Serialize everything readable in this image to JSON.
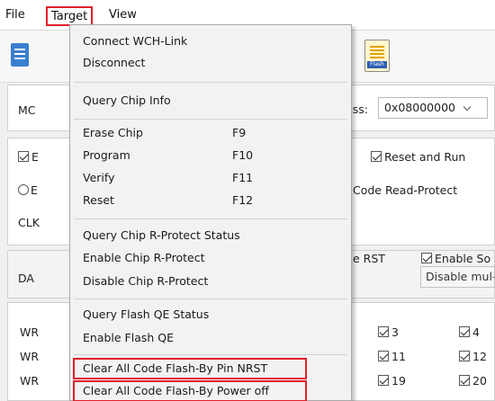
{
  "menubar": {
    "file": "File",
    "target": "Target",
    "view": "View"
  },
  "background": {
    "mcu_label": "MC",
    "address_label": "ess:",
    "address_value": "0x08000000",
    "checkbox_left": "E",
    "radio_left": "E",
    "reset_and_run": "Reset and Run",
    "code_read_protect": "Code Read-Protect",
    "clk_label": "CLK",
    "rst_label": "e RST",
    "enable_so": "Enable So",
    "da_label": "DA",
    "disable_mul": "Disable mul-",
    "wr_labels": [
      "WR",
      "WR",
      "WR"
    ],
    "sector_checks_col1": [
      "3",
      "11",
      "19"
    ],
    "sector_checks_col2": [
      "4",
      "12",
      "20"
    ]
  },
  "target_menu": {
    "groups": [
      {
        "items": [
          {
            "label": "Connect  WCH-Link"
          },
          {
            "label": "Disconnect"
          }
        ]
      },
      {
        "items": [
          {
            "label": "Query Chip Info"
          }
        ]
      },
      {
        "items": [
          {
            "label": "Erase Chip",
            "shortcut": "F9"
          },
          {
            "label": "Program",
            "shortcut": "F10"
          },
          {
            "label": "Verify",
            "shortcut": "F11"
          },
          {
            "label": "Reset",
            "shortcut": "F12"
          }
        ]
      },
      {
        "items": [
          {
            "label": "Query Chip R-Protect Status"
          },
          {
            "label": "Enable Chip R-Protect"
          },
          {
            "label": "Disable Chip R-Protect"
          }
        ]
      },
      {
        "items": [
          {
            "label": "Query Flash QE Status"
          },
          {
            "label": "Enable Flash QE"
          }
        ]
      },
      {
        "items": [
          {
            "label": "Clear All Code Flash-By Pin NRST"
          },
          {
            "label": "Clear All Code Flash-By Power off"
          }
        ]
      }
    ]
  },
  "colors": {
    "highlight": "#e0202a",
    "menu_bg": "#f2f2f2"
  }
}
